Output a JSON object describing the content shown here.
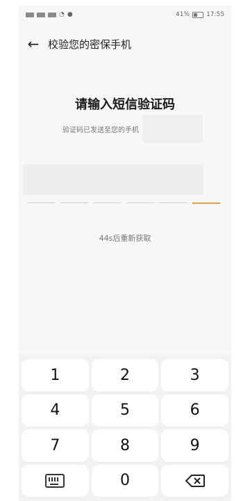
{
  "status": {
    "left_icons": [
      "sim-icon",
      "signal-icon",
      "signal-icon",
      "wifi-icon",
      "chat-icon"
    ],
    "battery": "41%",
    "time": "17:55"
  },
  "header": {
    "back_icon": "arrow-left-icon",
    "title": "校验您的密保手机"
  },
  "main": {
    "title": "请输入短信验证码",
    "sent_text": "验证码已发送至您的手机",
    "resend_text": "44s后重新获取",
    "accent_color": "#d9a14a"
  },
  "keypad": {
    "keys": [
      "1",
      "2",
      "3",
      "4",
      "5",
      "6",
      "7",
      "8",
      "9",
      "keyboard-icon",
      "0",
      "backspace-icon"
    ]
  }
}
